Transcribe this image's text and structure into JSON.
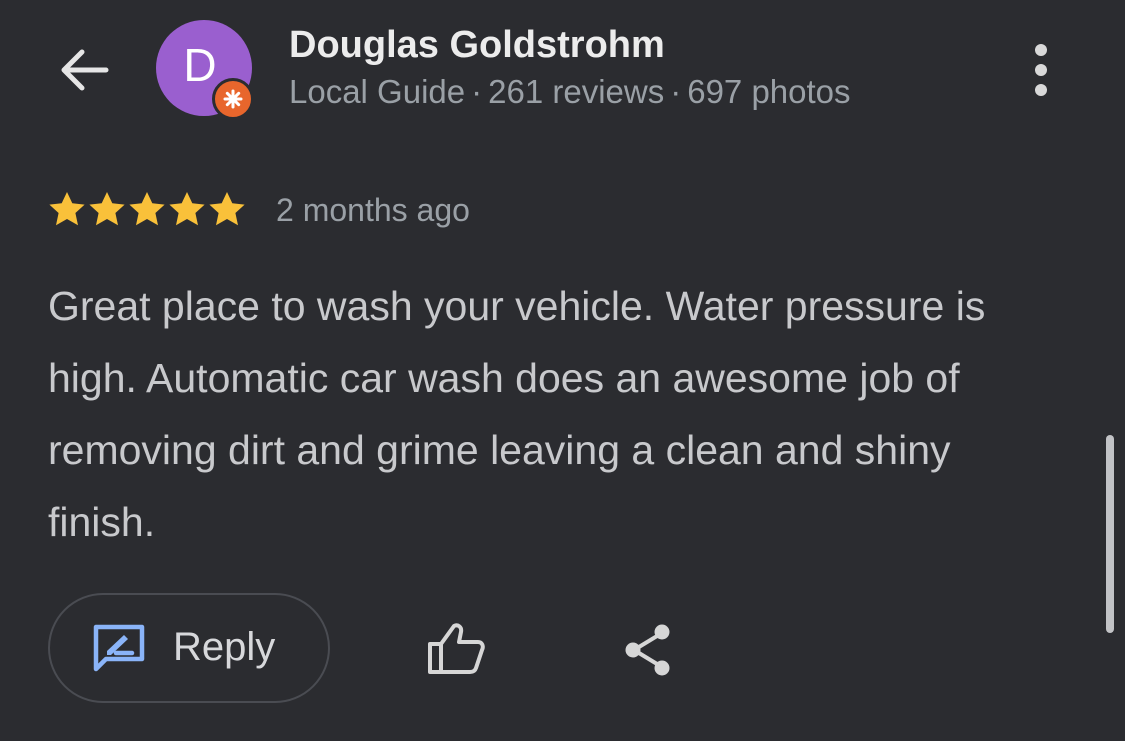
{
  "colors": {
    "background": "#2b2c30",
    "avatar": "#9a5fcf",
    "badge": "#e8662c",
    "star": "#f9c13a",
    "reply_icon": "#8ab4f8",
    "secondary_text": "#9aa0a6"
  },
  "icons": {
    "back": "arrow-left-icon",
    "badge": "local-guide-badge-icon",
    "more": "more-vert-icon",
    "star": "star-icon",
    "reply": "rate-review-icon",
    "like": "thumb-up-icon",
    "share": "share-icon"
  },
  "reviewer": {
    "avatar_letter": "D",
    "name": "Douglas Goldstrohm",
    "level": "Local Guide",
    "separator": "·",
    "reviews": "261 reviews",
    "photos": "697 photos"
  },
  "review": {
    "rating": 5,
    "max_rating": 5,
    "date": "2 months ago",
    "text": "Great place to wash your vehicle. Water pressure is high. Automatic car wash does an awesome job of removing dirt and grime leaving a clean and shiny finish."
  },
  "actions": {
    "reply_label": "Reply"
  },
  "scroll": {
    "position_fraction": 0.78
  }
}
